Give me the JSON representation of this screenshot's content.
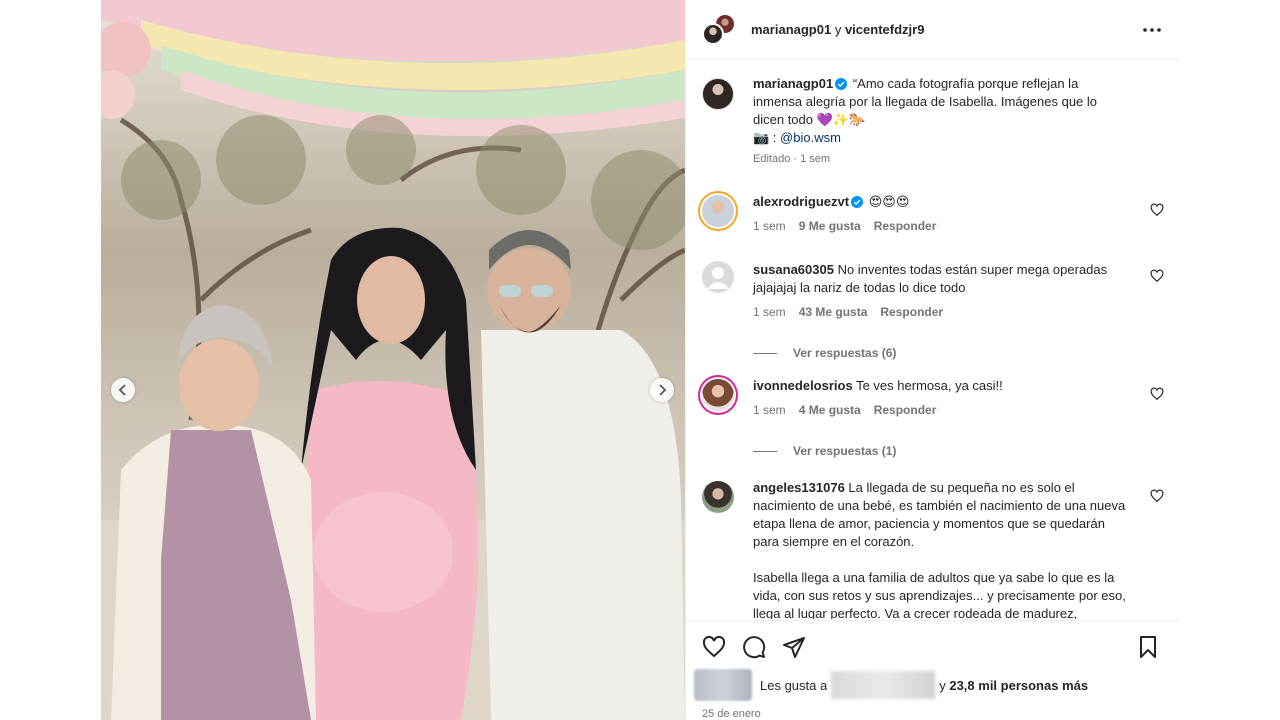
{
  "post": {
    "collab_users": "marianagp01",
    "and_word": "y",
    "collab_users_2": "vicentefdzjr9"
  },
  "caption": {
    "username": "marianagp01",
    "text": "“Amo cada fotografía porque reflejan la inmensa alegría por la llegada de Isabella. Imágenes que lo dicen todo 💜✨🐎",
    "credit_prefix": "📷 : ",
    "credit_link": "@bio.wsm",
    "edited": "Editado",
    "time": "1 sem"
  },
  "comments": [
    {
      "username": "alexrodriguezvt",
      "verified": true,
      "text": "😍😍😍",
      "time": "1 sem",
      "likes": "9 Me gusta",
      "reply": "Responder"
    },
    {
      "username": "susana60305",
      "text": "No inventes todas están super mega operadas jajajajaj la nariz de todas lo dice todo",
      "time": "1 sem",
      "likes": "43 Me gusta",
      "reply": "Responder",
      "view_replies": "Ver respuestas (6)"
    },
    {
      "username": "ivonnedelosrios",
      "text": "Te ves hermosa, ya casi!!",
      "time": "1 sem",
      "likes": "4 Me gusta",
      "reply": "Responder",
      "view_replies": "Ver respuestas (1)"
    },
    {
      "username": "angeles131076",
      "text": "La llegada de su pequeña no es solo el nacimiento de una bebé, es también el nacimiento de una nueva etapa llena de amor, paciencia y momentos que se quedarán para siempre en el corazón.",
      "text2": "Isabella llega a una familia de adultos que ya sabe lo que es la vida, con sus retos y sus aprendizajes... y precisamente por eso, llega al lugar perfecto. Va a crecer rodeada de madurez,"
    }
  ],
  "footer": {
    "likes_prefix": "Les gusta a",
    "likes_and": "y",
    "likes_count": "23,8 mil personas más",
    "date": "25 de enero"
  },
  "icons": {
    "more": "more-horizontal-icon",
    "like": "heart-icon",
    "comment": "comment-icon",
    "share": "send-icon",
    "save": "bookmark-icon"
  },
  "colors": {
    "verified": "#0095f6",
    "secondary_text": "#737373",
    "link": "#00376b"
  }
}
